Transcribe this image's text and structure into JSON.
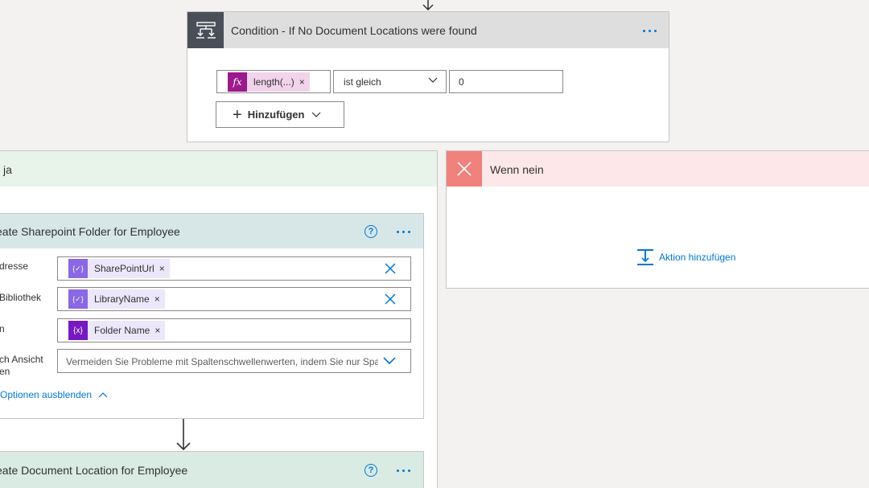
{
  "condition": {
    "title": "Condition - If No Document Locations were found",
    "expression_token": "length(...)",
    "expression_token_icon": "fx-icon",
    "operator": "ist gleich",
    "value": "0",
    "add_button": "Hinzufügen"
  },
  "yes_branch": {
    "title": "ja"
  },
  "no_branch": {
    "title": "Wenn nein",
    "add_action": "Aktion hinzufügen"
  },
  "create_folder": {
    "title": "eate Sharepoint Folder for Employee",
    "fields": [
      {
        "label": "dresse",
        "token": "SharePointUrl"
      },
      {
        "label": "Bibliothek",
        "token": "LibraryName"
      },
      {
        "label": "n",
        "token": "Folder Name"
      },
      {
        "label_line1": "ch Ansicht",
        "label_line2": "en",
        "value": "Vermeiden Sie Probleme mit Spaltenschwellenwerten, indem Sie nur Spalten"
      }
    ],
    "hide_options": "Optionen ausblenden"
  },
  "create_location": {
    "title": "eate Document Location for Employee"
  },
  "colors": {
    "accent": "#0078d4",
    "condition_header": "#dedede",
    "condition_icon_bg": "#484f58",
    "yes_header": "#e8f4ea",
    "no_header": "#fde7e9",
    "no_icon_bg": "#f1817d",
    "fx_token_bg": "#f2d3ec",
    "fx_icon_bg": "#9b1a8c",
    "var_icon_bg": "#8a67e3",
    "var_icon_dark_bg": "#7718c0",
    "var_token_bg": "#ece7fb"
  }
}
